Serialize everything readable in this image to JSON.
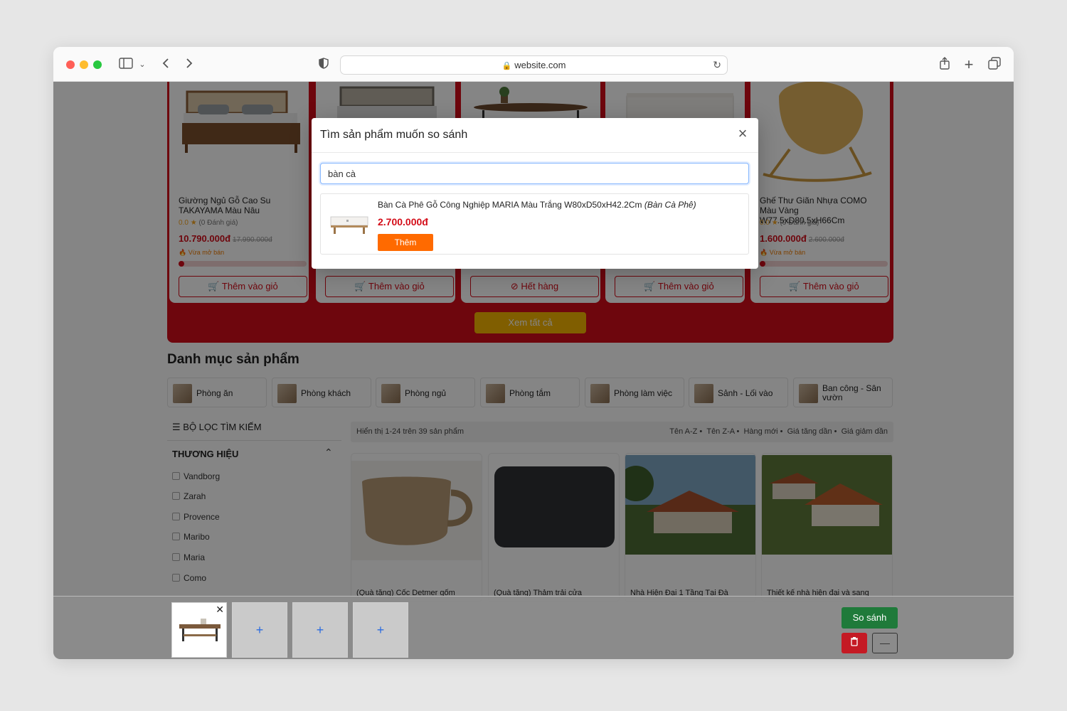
{
  "browser": {
    "url": "website.com"
  },
  "flash_sale": {
    "products": [
      {
        "name": "Giường Ngủ Gỗ Cao Su TAKAYAMA Màu Nâu",
        "rating": "0.0",
        "reviews": "(0 Đánh giá)",
        "price": "10.790.000đ",
        "old_price": "17.990.000đ",
        "sold": "Vừa mở bán",
        "button": "Thêm vào giỏ"
      },
      {
        "name": "",
        "rating": "",
        "reviews": "",
        "price": "",
        "old_price": "",
        "sold": "",
        "button": "Thêm vào giỏ"
      },
      {
        "name": "",
        "rating": "",
        "reviews": "",
        "price": "",
        "old_price": "",
        "sold": "",
        "button": "Hết hàng"
      },
      {
        "name": "",
        "rating": "",
        "reviews": "",
        "price": "",
        "old_price": "",
        "sold": "",
        "button": "Thêm vào giỏ"
      },
      {
        "name": "Ghế Thư Giãn Nhựa COMO Màu Vàng W77.5xD80.5xH66Cm",
        "rating": "0.0",
        "reviews": "(0 Đánh giá)",
        "price": "1.600.000đ",
        "old_price": "2.600.000đ",
        "sold": "Vừa mở bán",
        "button": "Thêm vào giỏ"
      }
    ],
    "see_all": "Xem tất cả"
  },
  "categories": {
    "title": "Danh mục sản phẩm",
    "items": [
      "Phòng ăn",
      "Phòng khách",
      "Phòng ngủ",
      "Phòng tắm",
      "Phòng làm việc",
      "Sảnh - Lối vào",
      "Ban công - Sân vườn"
    ]
  },
  "filter": {
    "title": "BỘ LỌC TÌM KIẾM",
    "brand_title": "THƯƠNG HIỆU",
    "brands": [
      "Vandborg",
      "Zarah",
      "Provence",
      "Maribo",
      "Maria",
      "Como"
    ]
  },
  "listing": {
    "showing": "Hiển thị 1-24 trên 39 sản phẩm",
    "sort_options": [
      "Tên A-Z",
      "Tên Z-A",
      "Hàng mới",
      "Giá tăng dần",
      "Giá giảm dần"
    ],
    "products": [
      "(Quà tặng) Cốc Detmer gốm",
      "(Quà tặng) Thảm trải cửa",
      "Nhà Hiện Đại 1 Tầng Tại Đà",
      "Thiết kế nhà hiện đại và sang"
    ]
  },
  "modal": {
    "title": "Tìm sản phẩm muốn so sánh",
    "search_value": "bàn cà",
    "result": {
      "name": "Bàn Cà Phê Gỗ Công Nghiệp MARIA Màu Trắng W80xD50xH42.2Cm",
      "category": "(Bàn Cà Phê)",
      "price": "2.700.000đ",
      "add_label": "Thêm"
    }
  },
  "compare_bar": {
    "plus": "+",
    "compare_label": "So sánh",
    "minimize": "—"
  },
  "colors": {
    "brand_red": "#d40d19",
    "add_orange": "#ff6a00",
    "compare_green": "#1f7a3a",
    "see_all_yellow": "#f6b400"
  }
}
